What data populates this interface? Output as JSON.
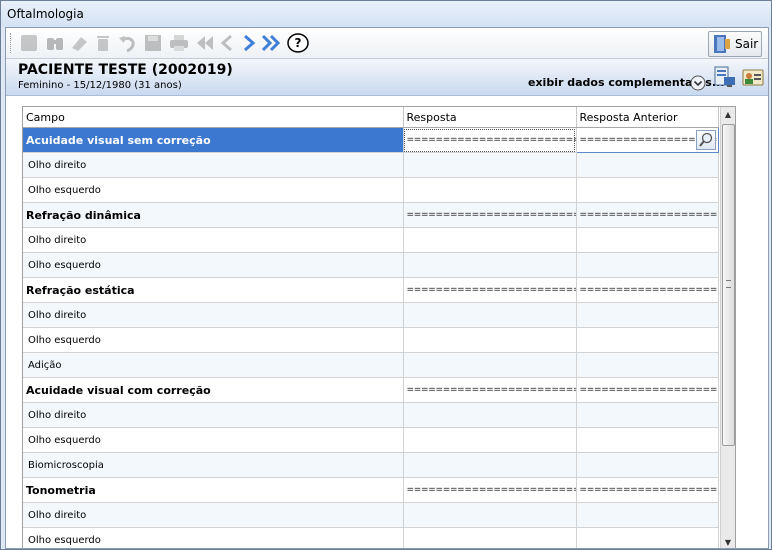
{
  "window": {
    "title": "Oftalmologia"
  },
  "toolbar": {
    "sair_label": "Sair",
    "help_glyph": "?"
  },
  "patient": {
    "name": "PACIENTE TESTE (2002019)",
    "info": "Feminino - 15/12/1980 (31 anos)",
    "complementary_link": "exibir dados complementares..."
  },
  "grid": {
    "headers": [
      "Campo",
      "Resposta",
      "Resposta Anterior"
    ],
    "rows": [
      {
        "label": "Acuidade visual sem correção",
        "group": true,
        "selected": true,
        "resposta": "================================",
        "anterior": "========================"
      },
      {
        "label": "Olho direito",
        "group": false,
        "resposta": "",
        "anterior": ""
      },
      {
        "label": "Olho esquerdo",
        "group": false,
        "resposta": "",
        "anterior": ""
      },
      {
        "label": "Refração dinâmica",
        "group": true,
        "resposta": "================================",
        "anterior": "================================"
      },
      {
        "label": "Olho direito",
        "group": false,
        "resposta": "",
        "anterior": ""
      },
      {
        "label": "Olho esquerdo",
        "group": false,
        "resposta": "",
        "anterior": ""
      },
      {
        "label": "Refração estática",
        "group": true,
        "resposta": "================================",
        "anterior": "================================"
      },
      {
        "label": "Olho direito",
        "group": false,
        "resposta": "",
        "anterior": ""
      },
      {
        "label": "Olho esquerdo",
        "group": false,
        "resposta": "",
        "anterior": ""
      },
      {
        "label": "Adição",
        "group": false,
        "resposta": "",
        "anterior": ""
      },
      {
        "label": "Acuidade visual com correção",
        "group": true,
        "resposta": "================================",
        "anterior": "================================"
      },
      {
        "label": "Olho direito",
        "group": false,
        "resposta": "",
        "anterior": ""
      },
      {
        "label": "Olho esquerdo",
        "group": false,
        "resposta": "",
        "anterior": ""
      },
      {
        "label": "Biomicroscopia",
        "group": false,
        "resposta": "",
        "anterior": ""
      },
      {
        "label": "Tonometria",
        "group": true,
        "resposta": "================================",
        "anterior": "================================"
      },
      {
        "label": "Olho direito",
        "group": false,
        "resposta": "",
        "anterior": ""
      },
      {
        "label": "Olho esquerdo",
        "group": false,
        "resposta": "",
        "anterior": ""
      }
    ]
  },
  "icons": {
    "toolbar": [
      "new-record-icon",
      "binoculars-icon",
      "eraser-icon",
      "trash-icon",
      "undo-icon",
      "save-icon",
      "print-icon",
      "first-record-icon",
      "previous-record-icon",
      "next-record-icon",
      "last-record-icon",
      "help-icon"
    ],
    "header": [
      "expand-circle-icon",
      "computer-data-icon",
      "user-card-icon"
    ]
  },
  "colors": {
    "selection": "#3d78d0",
    "header_gradient_end": "#c8d9ef",
    "alt_row": "#f3f8fd"
  }
}
